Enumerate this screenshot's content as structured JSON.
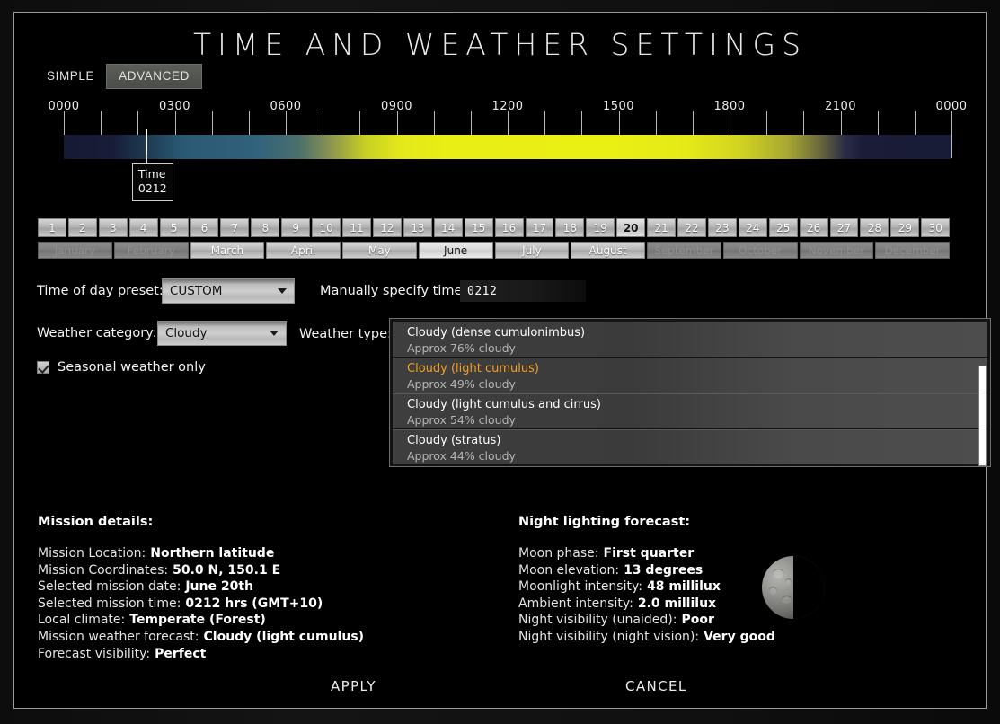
{
  "window": {
    "title": "TIME AND WEATHER SETTINGS"
  },
  "tabs": [
    {
      "label": "SIMPLE",
      "active": false
    },
    {
      "label": "ADVANCED",
      "active": true
    }
  ],
  "timeline": {
    "tick_labels": [
      "0000",
      "0300",
      "0600",
      "0900",
      "1200",
      "1500",
      "1800",
      "2100",
      "0000"
    ],
    "marker": {
      "tooltip_title": "Time",
      "tooltip_value": "0212",
      "position_percent": 9.2
    },
    "colors": {
      "night": "#171a33",
      "dawn": "#2e5e78",
      "day": "#eaef14",
      "dusk": "#6e6c3c"
    }
  },
  "days": {
    "items": [
      "1",
      "2",
      "3",
      "4",
      "5",
      "6",
      "7",
      "8",
      "9",
      "10",
      "11",
      "12",
      "13",
      "14",
      "15",
      "16",
      "17",
      "18",
      "19",
      "20",
      "21",
      "22",
      "23",
      "24",
      "25",
      "26",
      "27",
      "28",
      "29",
      "30"
    ],
    "selected": "20"
  },
  "months": {
    "items": [
      {
        "label": "January",
        "state": "disabled"
      },
      {
        "label": "February",
        "state": "disabled"
      },
      {
        "label": "March",
        "state": "enabled"
      },
      {
        "label": "April",
        "state": "enabled"
      },
      {
        "label": "May",
        "state": "enabled"
      },
      {
        "label": "June",
        "state": "selected"
      },
      {
        "label": "July",
        "state": "enabled"
      },
      {
        "label": "August",
        "state": "enabled"
      },
      {
        "label": "September",
        "state": "disabled"
      },
      {
        "label": "October",
        "state": "disabled"
      },
      {
        "label": "November",
        "state": "disabled"
      },
      {
        "label": "December",
        "state": "disabled"
      }
    ],
    "selected": "June"
  },
  "controls": {
    "time_preset_label": "Time of day preset:",
    "time_preset_value": "CUSTOM",
    "manual_time_label": "Manually specify time:",
    "manual_time_value": "0212",
    "weather_category_label": "Weather category:",
    "weather_category_value": "Cloudy",
    "weather_type_label": "Weather type:",
    "seasonal_checkbox_label": "Seasonal weather only",
    "seasonal_checked": true
  },
  "weather_types": [
    {
      "name": "Cloudy (dense cumulonimbus)",
      "sub": "Approx 76% cloudy",
      "selected": false
    },
    {
      "name": "Cloudy (light cumulus)",
      "sub": "Approx 49% cloudy",
      "selected": true
    },
    {
      "name": "Cloudy (light cumulus and cirrus)",
      "sub": "Approx 54% cloudy",
      "selected": false
    },
    {
      "name": "Cloudy (stratus)",
      "sub": "Approx 44% cloudy",
      "selected": false
    }
  ],
  "mission": {
    "heading": "Mission details:",
    "rows": [
      {
        "label": "Mission Location:",
        "value": "Northern latitude"
      },
      {
        "label": "Mission Coordinates:",
        "value": "50.0 N, 150.1 E"
      },
      {
        "label": "Selected mission date:",
        "value": "June 20th"
      },
      {
        "label": "Selected mission time:",
        "value": "0212 hrs (GMT+10)"
      },
      {
        "label": "Local climate:",
        "value": "Temperate (Forest)"
      },
      {
        "label": "Mission weather forecast:",
        "value": "Cloudy (light cumulus)"
      },
      {
        "label": "Forecast visibility:",
        "value": "Perfect"
      }
    ]
  },
  "night": {
    "heading": "Night lighting forecast:",
    "rows": [
      {
        "label": "Moon phase:",
        "value": "First quarter"
      },
      {
        "label": "Moon elevation:",
        "value": "13 degrees"
      },
      {
        "label": "Moonlight intensity:",
        "value": "48 millilux"
      },
      {
        "label": "Ambient intensity:",
        "value": "2.0 millilux"
      },
      {
        "label": "Night visibility (unaided):",
        "value": "Poor"
      },
      {
        "label": "Night visibility (night vision):",
        "value": "Very good"
      }
    ],
    "moon_icon": "moon-first-quarter"
  },
  "footer": {
    "apply_label": "APPLY",
    "cancel_label": "CANCEL"
  },
  "accent": {
    "selected_item": "#f2a024",
    "panel_border": "#9a9a9a"
  }
}
